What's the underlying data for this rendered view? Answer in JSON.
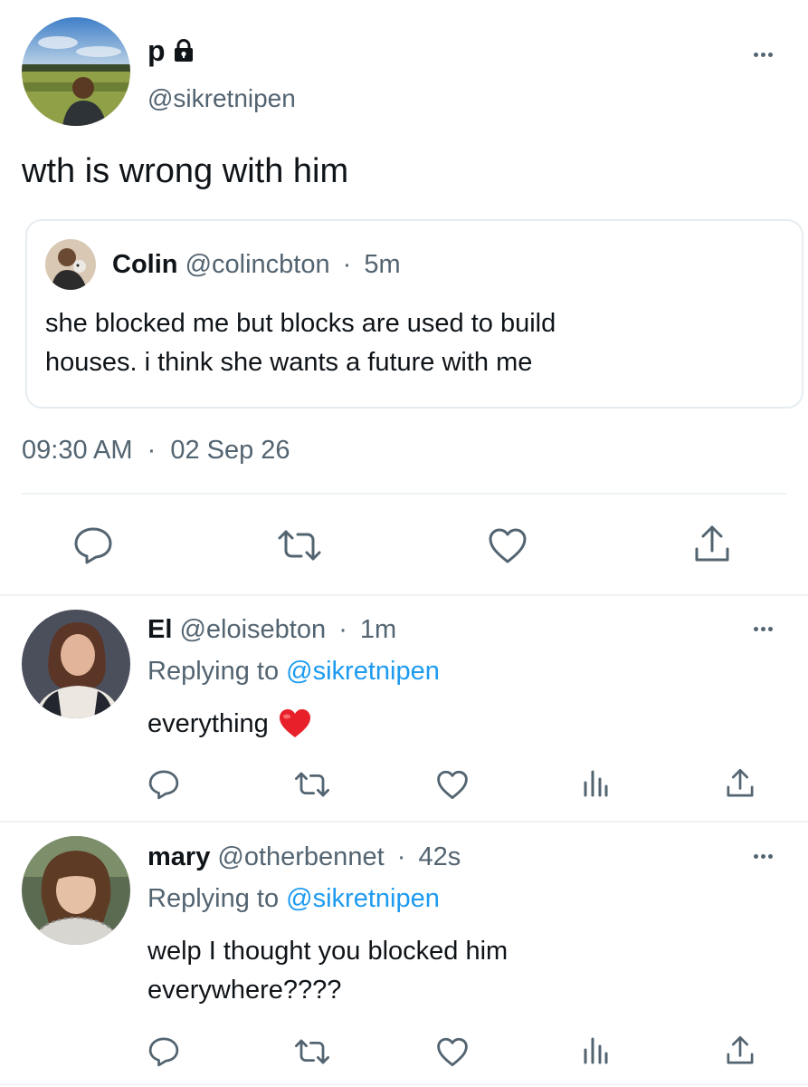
{
  "main_tweet": {
    "display_name": "p",
    "handle": "@sikretnipen",
    "text": "wth is wrong with him",
    "timestamp": "09:30 AM",
    "date": "02 Sep 26",
    "dot": "·"
  },
  "quoted_tweet": {
    "display_name": "Colin",
    "handle": "@colincbton",
    "dot": "·",
    "time": "5m",
    "text_line1": "she blocked me but blocks are used to build",
    "text_line2": "houses. i think she wants a future with me"
  },
  "replies": [
    {
      "display_name": "El",
      "handle": "@eloisebton",
      "dot": "·",
      "time": "1m",
      "replying_prefix": "Replying to",
      "replying_handle": "@sikretnipen",
      "text": "everything"
    },
    {
      "display_name": "mary",
      "handle": "@otherbennet",
      "dot": "·",
      "time": "42s",
      "replying_prefix": "Replying to",
      "replying_handle": "@sikretnipen",
      "text_line1": "welp I thought you blocked him",
      "text_line2": "everywhere????"
    }
  ],
  "icons": {
    "lock": "lock-icon",
    "reply": "reply-icon",
    "retweet": "retweet-icon",
    "like": "heart-icon",
    "views": "analytics-icon",
    "share": "share-icon",
    "emoji": "red-heart-emoji",
    "more": "more-icon"
  },
  "colors": {
    "text": "#0f1419",
    "secondary": "#536471",
    "link": "#1d9bf0",
    "heart_emoji": "#e8202a"
  }
}
